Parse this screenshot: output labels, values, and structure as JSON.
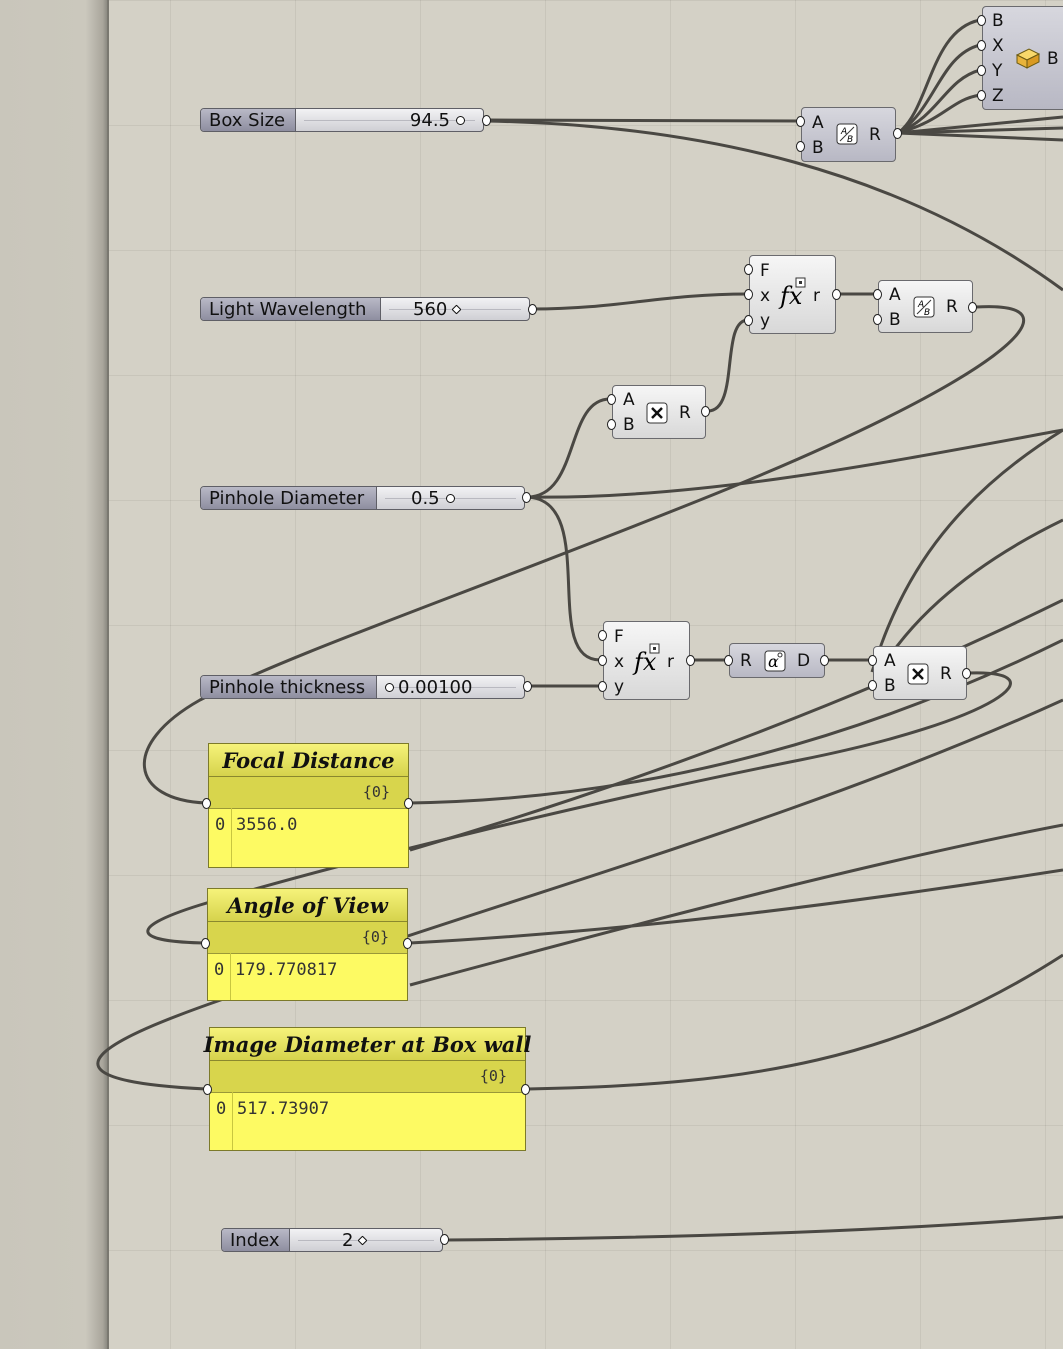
{
  "sliders": {
    "box_size": {
      "label": "Box Size",
      "value": "94.5"
    },
    "light_wavelength": {
      "label": "Light Wavelength",
      "value": "560"
    },
    "pinhole_diameter": {
      "label": "Pinhole Diameter",
      "value": "0.5"
    },
    "pinhole_thickness": {
      "label": "Pinhole thickness",
      "value": "0.00100"
    },
    "index": {
      "label": "Index",
      "value": "2"
    }
  },
  "components": {
    "box": {
      "inputs": [
        "B",
        "X",
        "Y",
        "Z"
      ],
      "output": "B"
    },
    "division_1": {
      "inputs": [
        "A",
        "B"
      ],
      "output": "R"
    },
    "expression_1": {
      "inputs": [
        "F",
        "x",
        "y"
      ],
      "output": "r"
    },
    "division_2": {
      "inputs": [
        "A",
        "B"
      ],
      "output": "R"
    },
    "multiplication_1": {
      "inputs": [
        "A",
        "B"
      ],
      "output": "R"
    },
    "expression_2": {
      "inputs": [
        "F",
        "x",
        "y"
      ],
      "output": "r"
    },
    "degrees": {
      "input": "R",
      "output": "D"
    },
    "multiplication_2": {
      "inputs": [
        "A",
        "B"
      ],
      "output": "R"
    }
  },
  "panels": {
    "focal_distance": {
      "title": "Focal Distance",
      "path": "{0}",
      "index": "0",
      "value": "3556.0"
    },
    "angle_of_view": {
      "title": "Angle of View",
      "path": "{0}",
      "index": "0",
      "value": "179.770817"
    },
    "image_diameter": {
      "title": "Image Diameter at Box wall",
      "path": "{0}",
      "index": "0",
      "value": "517.73907"
    }
  },
  "icons": {
    "division": "division-icon",
    "multiplication": "multiplication-icon",
    "expression": "expression-icon",
    "degrees": "degrees-icon",
    "box": "box-icon"
  },
  "colors": {
    "canvas": "#d4d1c6",
    "panel": "#fdfa63",
    "wire": "#4a4843"
  }
}
